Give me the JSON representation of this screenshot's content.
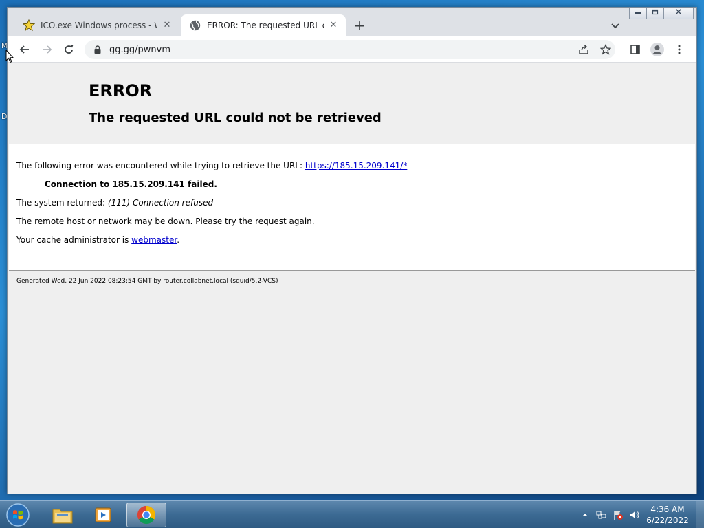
{
  "desktop": {
    "labels": [
      "M",
      "D"
    ]
  },
  "browser": {
    "tabs": [
      {
        "title": "ICO.exe Windows process - What",
        "icon": "star-icon",
        "active": false
      },
      {
        "title": "ERROR: The requested URL could",
        "icon": "globe-icon",
        "active": true
      }
    ],
    "close_glyph": "✕",
    "new_tab_glyph": "+",
    "omnibox": {
      "url": "gg.gg/pwnvm"
    }
  },
  "page": {
    "title": "ERROR",
    "subtitle": "The requested URL could not be retrieved",
    "line1_prefix": "The following error was encountered while trying to retrieve the URL: ",
    "line1_link": "https://185.15.209.141/*",
    "line2": "Connection to 185.15.209.141 failed.",
    "line3_prefix": "The system returned: ",
    "line3_em": "(111) Connection refused",
    "line4": "The remote host or network may be down. Please try the request again.",
    "line5_prefix": "Your cache administrator is ",
    "line5_link": "webmaster",
    "line5_suffix": ".",
    "footer": "Generated Wed, 22 Jun 2022 08:23:54 GMT by router.collabnet.local (squid/5.2-VCS)"
  },
  "taskbar": {
    "apps": [
      "explorer-icon",
      "media-player-icon",
      "chrome-icon"
    ],
    "clock_time": "4:36 AM",
    "clock_date": "6/22/2022"
  },
  "colors": {
    "link": "#0000cc",
    "page_bg": "#efefef",
    "tab_strip": "#dee1e6"
  }
}
